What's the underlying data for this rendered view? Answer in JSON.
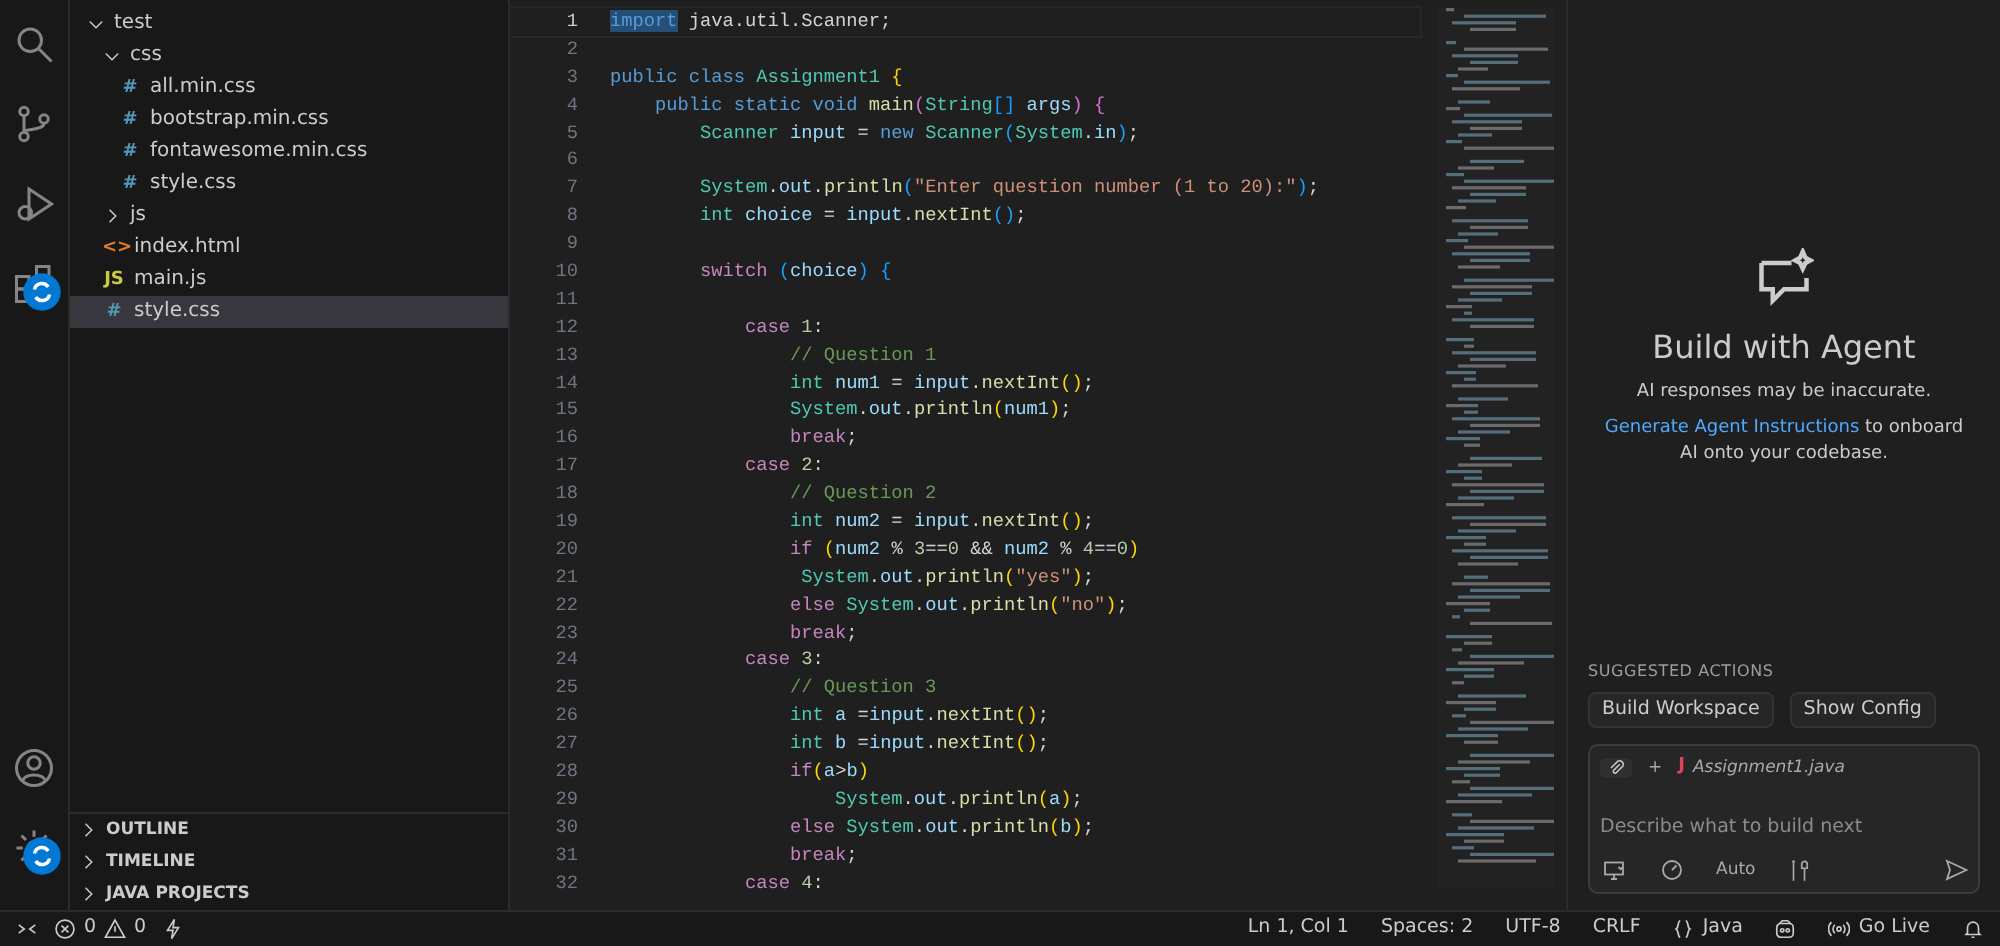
{
  "activity_bar": {
    "top": [
      {
        "kind": "search",
        "badge": false
      },
      {
        "kind": "source-control",
        "badge": false
      },
      {
        "kind": "run-debug",
        "badge": false
      },
      {
        "kind": "extensions",
        "badge": true
      }
    ],
    "bottom": [
      {
        "kind": "account",
        "badge": false
      },
      {
        "kind": "settings",
        "badge": true
      }
    ]
  },
  "explorer": {
    "tree": [
      {
        "label": "test",
        "folder": true,
        "expanded": true,
        "selected": false,
        "children": [
          {
            "label": "css",
            "folder": true,
            "expanded": true,
            "selected": false,
            "children": [
              {
                "label": "all.min.css",
                "kind": "css",
                "icon": "#",
                "selected": false
              },
              {
                "label": "bootstrap.min.css",
                "kind": "css",
                "icon": "#",
                "selected": false
              },
              {
                "label": "fontawesome.min.css",
                "kind": "css",
                "icon": "#",
                "selected": false
              },
              {
                "label": "style.css",
                "kind": "css",
                "icon": "#",
                "selected": false
              }
            ]
          },
          {
            "label": "js",
            "folder": true,
            "expanded": false,
            "selected": false
          },
          {
            "label": "index.html",
            "kind": "html",
            "icon": "<>",
            "selected": false
          },
          {
            "label": "main.js",
            "kind": "js",
            "icon": "JS",
            "selected": false
          },
          {
            "label": "style.css",
            "kind": "css",
            "icon": "#",
            "selected": true
          }
        ]
      }
    ],
    "sections": [
      {
        "label": "OUTLINE",
        "expanded": false
      },
      {
        "label": "TIMELINE",
        "expanded": false
      },
      {
        "label": "JAVA PROJECTS",
        "expanded": false
      }
    ]
  },
  "editor": {
    "lines": [
      {
        "number": "1",
        "current": true,
        "tokens": [
          {
            "kind": "hl",
            "text": "import"
          },
          {
            "kind": "p",
            "text": " java.util.Scanner;"
          }
        ]
      },
      {
        "number": "2",
        "current": false
      },
      {
        "number": "3",
        "current": false,
        "tokens": [
          {
            "kind": "kw",
            "text": "public"
          },
          {
            "kind": "kw",
            "text": " class"
          },
          {
            "kind": "type",
            "text": " Assignment1"
          },
          {
            "kind": "br",
            "text": " {"
          }
        ]
      },
      {
        "number": "4",
        "current": false,
        "tokens": [
          {
            "kind": "kw",
            "text": "    public"
          },
          {
            "kind": "kw",
            "text": " static"
          },
          {
            "kind": "kw",
            "text": " void"
          },
          {
            "kind": "fn",
            "text": " main"
          },
          {
            "kind": "br2",
            "text": "("
          },
          {
            "kind": "type",
            "text": "String"
          },
          {
            "kind": "br3",
            "text": "[]"
          },
          {
            "kind": "var",
            "text": " args"
          },
          {
            "kind": "br2",
            "text": ")"
          },
          {
            "kind": "br2",
            "text": " {"
          }
        ]
      },
      {
        "number": "5",
        "current": false,
        "tokens": [
          {
            "kind": "type",
            "text": "        Scanner"
          },
          {
            "kind": "var",
            "text": " input"
          },
          {
            "kind": "p",
            "text": " ="
          },
          {
            "kind": "kw",
            "text": " new"
          },
          {
            "kind": "type",
            "text": " Scanner"
          },
          {
            "kind": "br3",
            "text": "("
          },
          {
            "kind": "type",
            "text": "System"
          },
          {
            "kind": "p",
            "text": "."
          },
          {
            "kind": "var",
            "text": "in"
          },
          {
            "kind": "br3",
            "text": ")"
          },
          {
            "kind": "p",
            "text": ";"
          }
        ]
      },
      {
        "number": "6",
        "current": false
      },
      {
        "number": "7",
        "current": false,
        "tokens": [
          {
            "kind": "type",
            "text": "        System"
          },
          {
            "kind": "p",
            "text": "."
          },
          {
            "kind": "var",
            "text": "out"
          },
          {
            "kind": "p",
            "text": "."
          },
          {
            "kind": "fn",
            "text": "println"
          },
          {
            "kind": "br3",
            "text": "("
          },
          {
            "kind": "str",
            "text": "\"Enter question number (1 to 20):\""
          },
          {
            "kind": "br3",
            "text": ")"
          },
          {
            "kind": "p",
            "text": ";"
          }
        ]
      },
      {
        "number": "8",
        "current": false,
        "tokens": [
          {
            "kind": "type",
            "text": "        int"
          },
          {
            "kind": "var",
            "text": " choice"
          },
          {
            "kind": "p",
            "text": " ="
          },
          {
            "kind": "var",
            "text": " input"
          },
          {
            "kind": "p",
            "text": "."
          },
          {
            "kind": "fn",
            "text": "nextInt"
          },
          {
            "kind": "br3",
            "text": "()"
          },
          {
            "kind": "p",
            "text": ";"
          }
        ]
      },
      {
        "number": "9",
        "current": false
      },
      {
        "number": "10",
        "current": false,
        "tokens": [
          {
            "kind": "ctl",
            "text": "        switch"
          },
          {
            "kind": "br3",
            "text": " ("
          },
          {
            "kind": "var",
            "text": "choice"
          },
          {
            "kind": "br3",
            "text": ")"
          },
          {
            "kind": "br3",
            "text": " {"
          }
        ]
      },
      {
        "number": "11",
        "current": false
      },
      {
        "number": "12",
        "current": false,
        "tokens": [
          {
            "kind": "ctl",
            "text": "            case"
          },
          {
            "kind": "num",
            "text": " 1"
          },
          {
            "kind": "p",
            "text": ":"
          }
        ]
      },
      {
        "number": "13",
        "current": false,
        "tokens": [
          {
            "kind": "com",
            "text": "                // Question 1"
          }
        ]
      },
      {
        "number": "14",
        "current": false,
        "tokens": [
          {
            "kind": "type",
            "text": "                int"
          },
          {
            "kind": "var",
            "text": " num1"
          },
          {
            "kind": "p",
            "text": " ="
          },
          {
            "kind": "var",
            "text": " input"
          },
          {
            "kind": "p",
            "text": "."
          },
          {
            "kind": "fn",
            "text": "nextInt"
          },
          {
            "kind": "br",
            "text": "()"
          },
          {
            "kind": "p",
            "text": ";"
          }
        ]
      },
      {
        "number": "15",
        "current": false,
        "tokens": [
          {
            "kind": "type",
            "text": "                System"
          },
          {
            "kind": "p",
            "text": "."
          },
          {
            "kind": "var",
            "text": "out"
          },
          {
            "kind": "p",
            "text": "."
          },
          {
            "kind": "fn",
            "text": "println"
          },
          {
            "kind": "br",
            "text": "("
          },
          {
            "kind": "var",
            "text": "num1"
          },
          {
            "kind": "br",
            "text": ")"
          },
          {
            "kind": "p",
            "text": ";"
          }
        ]
      },
      {
        "number": "16",
        "current": false,
        "tokens": [
          {
            "kind": "ctl",
            "text": "                break"
          },
          {
            "kind": "p",
            "text": ";"
          }
        ]
      },
      {
        "number": "17",
        "current": false,
        "tokens": [
          {
            "kind": "ctl",
            "text": "            case"
          },
          {
            "kind": "num",
            "text": " 2"
          },
          {
            "kind": "p",
            "text": ":"
          }
        ]
      },
      {
        "number": "18",
        "current": false,
        "tokens": [
          {
            "kind": "com",
            "text": "                // Question 2"
          }
        ]
      },
      {
        "number": "19",
        "current": false,
        "tokens": [
          {
            "kind": "type",
            "text": "                int"
          },
          {
            "kind": "var",
            "text": " num2"
          },
          {
            "kind": "p",
            "text": " ="
          },
          {
            "kind": "var",
            "text": " input"
          },
          {
            "kind": "p",
            "text": "."
          },
          {
            "kind": "fn",
            "text": "nextInt"
          },
          {
            "kind": "br",
            "text": "()"
          },
          {
            "kind": "p",
            "text": ";"
          }
        ]
      },
      {
        "number": "20",
        "current": false,
        "tokens": [
          {
            "kind": "ctl",
            "text": "                if"
          },
          {
            "kind": "br",
            "text": " ("
          },
          {
            "kind": "var",
            "text": "num2"
          },
          {
            "kind": "p",
            "text": " %"
          },
          {
            "kind": "num",
            "text": " 3"
          },
          {
            "kind": "p",
            "text": "=="
          },
          {
            "kind": "num",
            "text": "0"
          },
          {
            "kind": "p",
            "text": " &&"
          },
          {
            "kind": "var",
            "text": " num2"
          },
          {
            "kind": "p",
            "text": " %"
          },
          {
            "kind": "num",
            "text": " 4"
          },
          {
            "kind": "p",
            "text": "=="
          },
          {
            "kind": "num",
            "text": "0"
          },
          {
            "kind": "br",
            "text": ")"
          }
        ]
      },
      {
        "number": "21",
        "current": false,
        "tokens": [
          {
            "kind": "type",
            "text": "                 System"
          },
          {
            "kind": "p",
            "text": "."
          },
          {
            "kind": "var",
            "text": "out"
          },
          {
            "kind": "p",
            "text": "."
          },
          {
            "kind": "fn",
            "text": "println"
          },
          {
            "kind": "br",
            "text": "("
          },
          {
            "kind": "str",
            "text": "\"yes\""
          },
          {
            "kind": "br",
            "text": ")"
          },
          {
            "kind": "p",
            "text": ";"
          }
        ]
      },
      {
        "number": "22",
        "current": false,
        "tokens": [
          {
            "kind": "ctl",
            "text": "                else"
          },
          {
            "kind": "type",
            "text": " System"
          },
          {
            "kind": "p",
            "text": "."
          },
          {
            "kind": "var",
            "text": "out"
          },
          {
            "kind": "p",
            "text": "."
          },
          {
            "kind": "fn",
            "text": "println"
          },
          {
            "kind": "br",
            "text": "("
          },
          {
            "kind": "str",
            "text": "\"no\""
          },
          {
            "kind": "br",
            "text": ")"
          },
          {
            "kind": "p",
            "text": ";"
          }
        ]
      },
      {
        "number": "23",
        "current": false,
        "tokens": [
          {
            "kind": "ctl",
            "text": "                break"
          },
          {
            "kind": "p",
            "text": ";"
          }
        ]
      },
      {
        "number": "24",
        "current": false,
        "tokens": [
          {
            "kind": "ctl",
            "text": "            case"
          },
          {
            "kind": "num",
            "text": " 3"
          },
          {
            "kind": "p",
            "text": ":"
          }
        ]
      },
      {
        "number": "25",
        "current": false,
        "tokens": [
          {
            "kind": "com",
            "text": "                // Question 3"
          }
        ]
      },
      {
        "number": "26",
        "current": false,
        "tokens": [
          {
            "kind": "type",
            "text": "                int"
          },
          {
            "kind": "var",
            "text": " a"
          },
          {
            "kind": "p",
            "text": " ="
          },
          {
            "kind": "var",
            "text": "input"
          },
          {
            "kind": "p",
            "text": "."
          },
          {
            "kind": "fn",
            "text": "nextInt"
          },
          {
            "kind": "br",
            "text": "()"
          },
          {
            "kind": "p",
            "text": ";"
          }
        ]
      },
      {
        "number": "27",
        "current": false,
        "tokens": [
          {
            "kind": "type",
            "text": "                int"
          },
          {
            "kind": "var",
            "text": " b"
          },
          {
            "kind": "p",
            "text": " ="
          },
          {
            "kind": "var",
            "text": "input"
          },
          {
            "kind": "p",
            "text": "."
          },
          {
            "kind": "fn",
            "text": "nextInt"
          },
          {
            "kind": "br",
            "text": "()"
          },
          {
            "kind": "p",
            "text": ";"
          }
        ]
      },
      {
        "number": "28",
        "current": false,
        "tokens": [
          {
            "kind": "ctl",
            "text": "                if"
          },
          {
            "kind": "br",
            "text": "("
          },
          {
            "kind": "var",
            "text": "a"
          },
          {
            "kind": "p",
            "text": ">"
          },
          {
            "kind": "var",
            "text": "b"
          },
          {
            "kind": "br",
            "text": ")"
          }
        ]
      },
      {
        "number": "29",
        "current": false,
        "tokens": [
          {
            "kind": "type",
            "text": "                    System"
          },
          {
            "kind": "p",
            "text": "."
          },
          {
            "kind": "var",
            "text": "out"
          },
          {
            "kind": "p",
            "text": "."
          },
          {
            "kind": "fn",
            "text": "println"
          },
          {
            "kind": "br",
            "text": "("
          },
          {
            "kind": "var",
            "text": "a"
          },
          {
            "kind": "br",
            "text": ")"
          },
          {
            "kind": "p",
            "text": ";"
          }
        ]
      },
      {
        "number": "30",
        "current": false,
        "tokens": [
          {
            "kind": "ctl",
            "text": "                else"
          },
          {
            "kind": "type",
            "text": " System"
          },
          {
            "kind": "p",
            "text": "."
          },
          {
            "kind": "var",
            "text": "out"
          },
          {
            "kind": "p",
            "text": "."
          },
          {
            "kind": "fn",
            "text": "println"
          },
          {
            "kind": "br",
            "text": "("
          },
          {
            "kind": "var",
            "text": "b"
          },
          {
            "kind": "br",
            "text": ")"
          },
          {
            "kind": "p",
            "text": ";"
          }
        ]
      },
      {
        "number": "31",
        "current": false,
        "tokens": [
          {
            "kind": "ctl",
            "text": "                break"
          },
          {
            "kind": "p",
            "text": ";"
          }
        ]
      },
      {
        "number": "32",
        "current": false,
        "tokens": [
          {
            "kind": "ctl",
            "text": "            case"
          },
          {
            "kind": "num",
            "text": " 4"
          },
          {
            "kind": "p",
            "text": ":"
          }
        ]
      }
    ]
  },
  "agent_panel": {
    "title": "Build with Agent",
    "subtitle": "AI responses may be inaccurate.",
    "link": "Generate Agent Instructions",
    "description": " to onboard AI onto your codebase.",
    "suggested_heading": "SUGGESTED ACTIONS",
    "suggested_actions": [
      "Build Workspace",
      "Show Config"
    ],
    "chat": {
      "attachment_add": "+",
      "file_icon": "J",
      "file": "Assignment1.java",
      "placeholder": "Describe what to build next",
      "model": "Auto"
    }
  },
  "status_bar": {
    "errors": "0",
    "warnings": "0",
    "position": "Ln 1, Col 1",
    "indent": "Spaces: 2",
    "encoding": "UTF-8",
    "eol": "CRLF",
    "language": "Java",
    "live": "Go Live"
  }
}
